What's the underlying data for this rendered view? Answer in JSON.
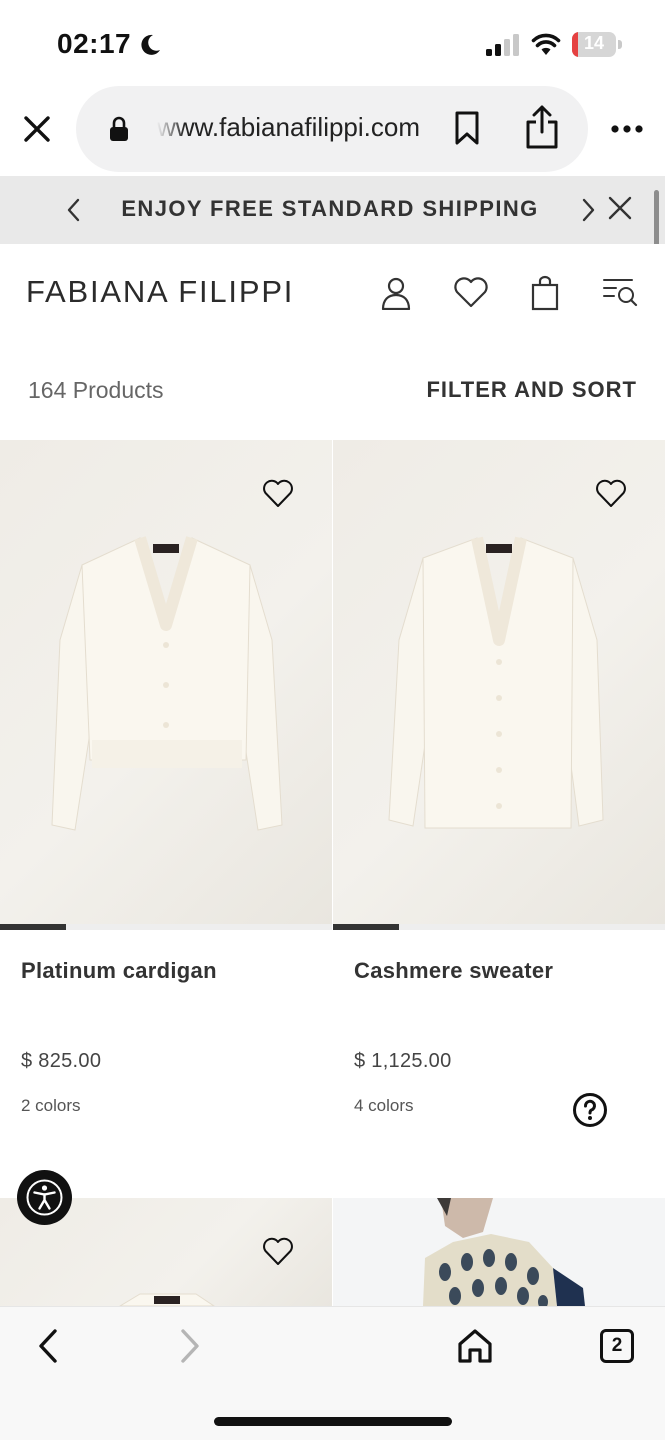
{
  "status_bar": {
    "time": "02:17",
    "battery_level": "14",
    "battery_fraction": 0.14
  },
  "browser": {
    "url": "www.fabianafilippi.com",
    "tab_count": "2"
  },
  "promo": {
    "text": "ENJOY FREE STANDARD SHIPPING"
  },
  "header": {
    "brand": "FABIANA FILIPPI"
  },
  "toolbar": {
    "product_count": "164 Products",
    "filter_sort_label": "FILTER AND SORT"
  },
  "products": [
    {
      "name": "Platinum cardigan",
      "price": "$ 825.00",
      "colors": "2 colors",
      "image_index": 1,
      "image_total": 5
    },
    {
      "name": "Cashmere sweater",
      "price": "$ 1,125.00",
      "colors": "4 colors",
      "image_index": 1,
      "image_total": 5
    }
  ],
  "icons": {
    "status": [
      "moon-icon",
      "signal-icon",
      "wifi-icon",
      "battery-icon"
    ],
    "browser": [
      "close-icon",
      "lock-icon",
      "bookmark-icon",
      "share-icon",
      "more-icon"
    ],
    "header": [
      "account-icon",
      "heart-icon",
      "shopping-bag-icon",
      "menu-search-icon"
    ],
    "nav": [
      "back-icon",
      "forward-icon",
      "home-icon",
      "tabs-icon"
    ],
    "floating": [
      "accessibility-icon",
      "help-icon"
    ]
  },
  "colors": {
    "banner_bg": "#e9e9e9",
    "text_dark": "#333333",
    "battery_low": "#e54141",
    "product_bg": "#efece6"
  }
}
